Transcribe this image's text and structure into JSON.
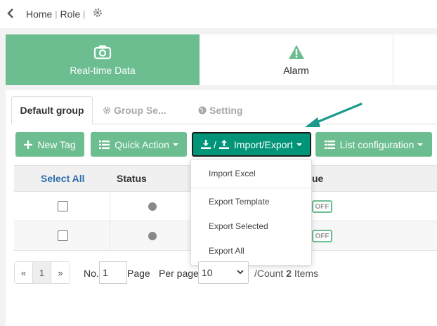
{
  "breadcrumb": {
    "home": "Home",
    "role": "Role"
  },
  "cards": [
    {
      "label": "Real-time Data",
      "icon": "camera-icon"
    },
    {
      "label": "Alarm",
      "icon": "warning-icon"
    }
  ],
  "tabs": [
    {
      "label": "Default group",
      "active": true
    },
    {
      "label": "Group Se...",
      "icon": "gear-icon"
    },
    {
      "label": "Setting",
      "icon": "globe-icon"
    }
  ],
  "toolbar": {
    "new_tag": "New Tag",
    "quick_action": "Quick Action",
    "import_export_sep": "/",
    "import_export": "Import/Export",
    "list_configuration": "List configuration"
  },
  "table": {
    "headers": {
      "select_all": "Select All",
      "status": "Status",
      "value": "ue"
    },
    "rows": [
      {
        "toggle": "OFF"
      },
      {
        "toggle": "OFF"
      }
    ]
  },
  "dropdown": {
    "items": [
      "Import Excel",
      "Export Template",
      "Export Selected",
      "Export All"
    ]
  },
  "pagination": {
    "prev": "«",
    "page": "1",
    "next": "»",
    "no_label": "No.",
    "page_input": "1",
    "page_label": "Page",
    "per_page_label": "Per page",
    "per_page_value": "10",
    "count_label": "/Count",
    "count_value": "2",
    "items_label": "Items"
  },
  "colors": {
    "accent": "#6cbe91",
    "import_button": "#009578",
    "arrow": "#1a9a8c"
  }
}
